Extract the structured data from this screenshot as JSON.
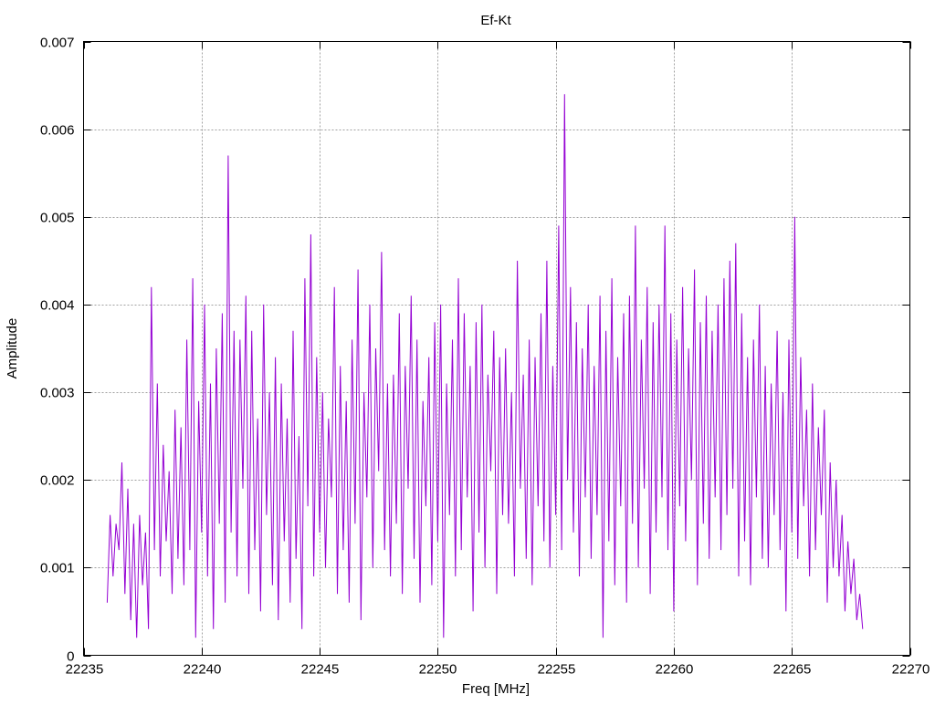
{
  "chart_data": {
    "type": "line",
    "title": "Ef-Kt",
    "xlabel": "Freq [MHz]",
    "ylabel": "Amplitude",
    "xlim": [
      22235,
      22270
    ],
    "ylim": [
      0,
      0.007
    ],
    "xticks": [
      "22235",
      "22240",
      "22245",
      "22250",
      "22255",
      "22260",
      "22265",
      "22270"
    ],
    "yticks": [
      "0",
      "0.001",
      "0.002",
      "0.003",
      "0.004",
      "0.005",
      "0.006",
      "0.007"
    ],
    "grid": true,
    "series": [
      {
        "name": "Ef-Kt",
        "color": "#9400d3",
        "x_start": 22236,
        "x_step": 0.125,
        "values": [
          0.0006,
          0.0016,
          0.0009,
          0.0015,
          0.0012,
          0.0022,
          0.0007,
          0.0019,
          0.0004,
          0.0015,
          0.0002,
          0.0016,
          0.0008,
          0.0014,
          0.0003,
          0.0042,
          0.0012,
          0.0031,
          0.0009,
          0.0024,
          0.0013,
          0.0021,
          0.0007,
          0.0028,
          0.0011,
          0.0026,
          0.0008,
          0.0036,
          0.0012,
          0.0043,
          0.0002,
          0.0029,
          0.0014,
          0.004,
          0.0009,
          0.0031,
          0.0003,
          0.0035,
          0.0015,
          0.0039,
          0.0006,
          0.0057,
          0.0014,
          0.0037,
          0.0009,
          0.0036,
          0.0019,
          0.0041,
          0.0007,
          0.0037,
          0.0012,
          0.0027,
          0.0005,
          0.004,
          0.0016,
          0.003,
          0.0008,
          0.0034,
          0.0004,
          0.0031,
          0.0013,
          0.0027,
          0.0006,
          0.0037,
          0.0011,
          0.0025,
          0.0003,
          0.0043,
          0.0017,
          0.0048,
          0.0009,
          0.0034,
          0.0014,
          0.003,
          0.001,
          0.0027,
          0.0018,
          0.0042,
          0.0007,
          0.0033,
          0.0012,
          0.0029,
          0.0006,
          0.0036,
          0.0015,
          0.0044,
          0.0004,
          0.003,
          0.0018,
          0.004,
          0.001,
          0.0035,
          0.0021,
          0.0046,
          0.0012,
          0.0031,
          0.0009,
          0.0032,
          0.0015,
          0.0039,
          0.0007,
          0.0033,
          0.0019,
          0.0041,
          0.0011,
          0.0036,
          0.0006,
          0.0029,
          0.0017,
          0.0034,
          0.0008,
          0.0038,
          0.0013,
          0.004,
          0.0002,
          0.0031,
          0.0016,
          0.0036,
          0.0009,
          0.0043,
          0.0012,
          0.0039,
          0.0018,
          0.0033,
          0.0005,
          0.0038,
          0.0014,
          0.004,
          0.001,
          0.0032,
          0.0021,
          0.0037,
          0.0007,
          0.0034,
          0.0016,
          0.0035,
          0.0015,
          0.003,
          0.0009,
          0.0045,
          0.0019,
          0.0032,
          0.0011,
          0.0036,
          0.0008,
          0.0034,
          0.0017,
          0.0039,
          0.0013,
          0.0045,
          0.001,
          0.0033,
          0.0016,
          0.0049,
          0.0012,
          0.0064,
          0.002,
          0.0042,
          0.0014,
          0.0038,
          0.0009,
          0.0035,
          0.0018,
          0.004,
          0.0011,
          0.0033,
          0.0016,
          0.0041,
          0.0002,
          0.0037,
          0.0013,
          0.0043,
          0.0008,
          0.0034,
          0.0017,
          0.0039,
          0.0006,
          0.0041,
          0.0015,
          0.0049,
          0.001,
          0.0036,
          0.0019,
          0.0042,
          0.0007,
          0.0038,
          0.0014,
          0.004,
          0.0018,
          0.0049,
          0.0012,
          0.0039,
          0.0005,
          0.0036,
          0.0017,
          0.0042,
          0.0013,
          0.0035,
          0.002,
          0.0044,
          0.0008,
          0.0038,
          0.0015,
          0.0041,
          0.0011,
          0.0037,
          0.0018,
          0.004,
          0.0012,
          0.0043,
          0.0016,
          0.0045,
          0.0019,
          0.0047,
          0.0009,
          0.0039,
          0.0013,
          0.0034,
          0.0008,
          0.0036,
          0.0018,
          0.004,
          0.0011,
          0.0033,
          0.001,
          0.0031,
          0.0016,
          0.0037,
          0.0012,
          0.003,
          0.0005,
          0.0036,
          0.0014,
          0.005,
          0.0011,
          0.0034,
          0.0017,
          0.0028,
          0.0009,
          0.0031,
          0.0012,
          0.0026,
          0.0016,
          0.0028,
          0.0006,
          0.0022,
          0.001,
          0.002,
          0.0009,
          0.0016,
          0.0005,
          0.0013,
          0.0007,
          0.0011,
          0.0004,
          0.0007,
          0.0003
        ]
      }
    ]
  }
}
